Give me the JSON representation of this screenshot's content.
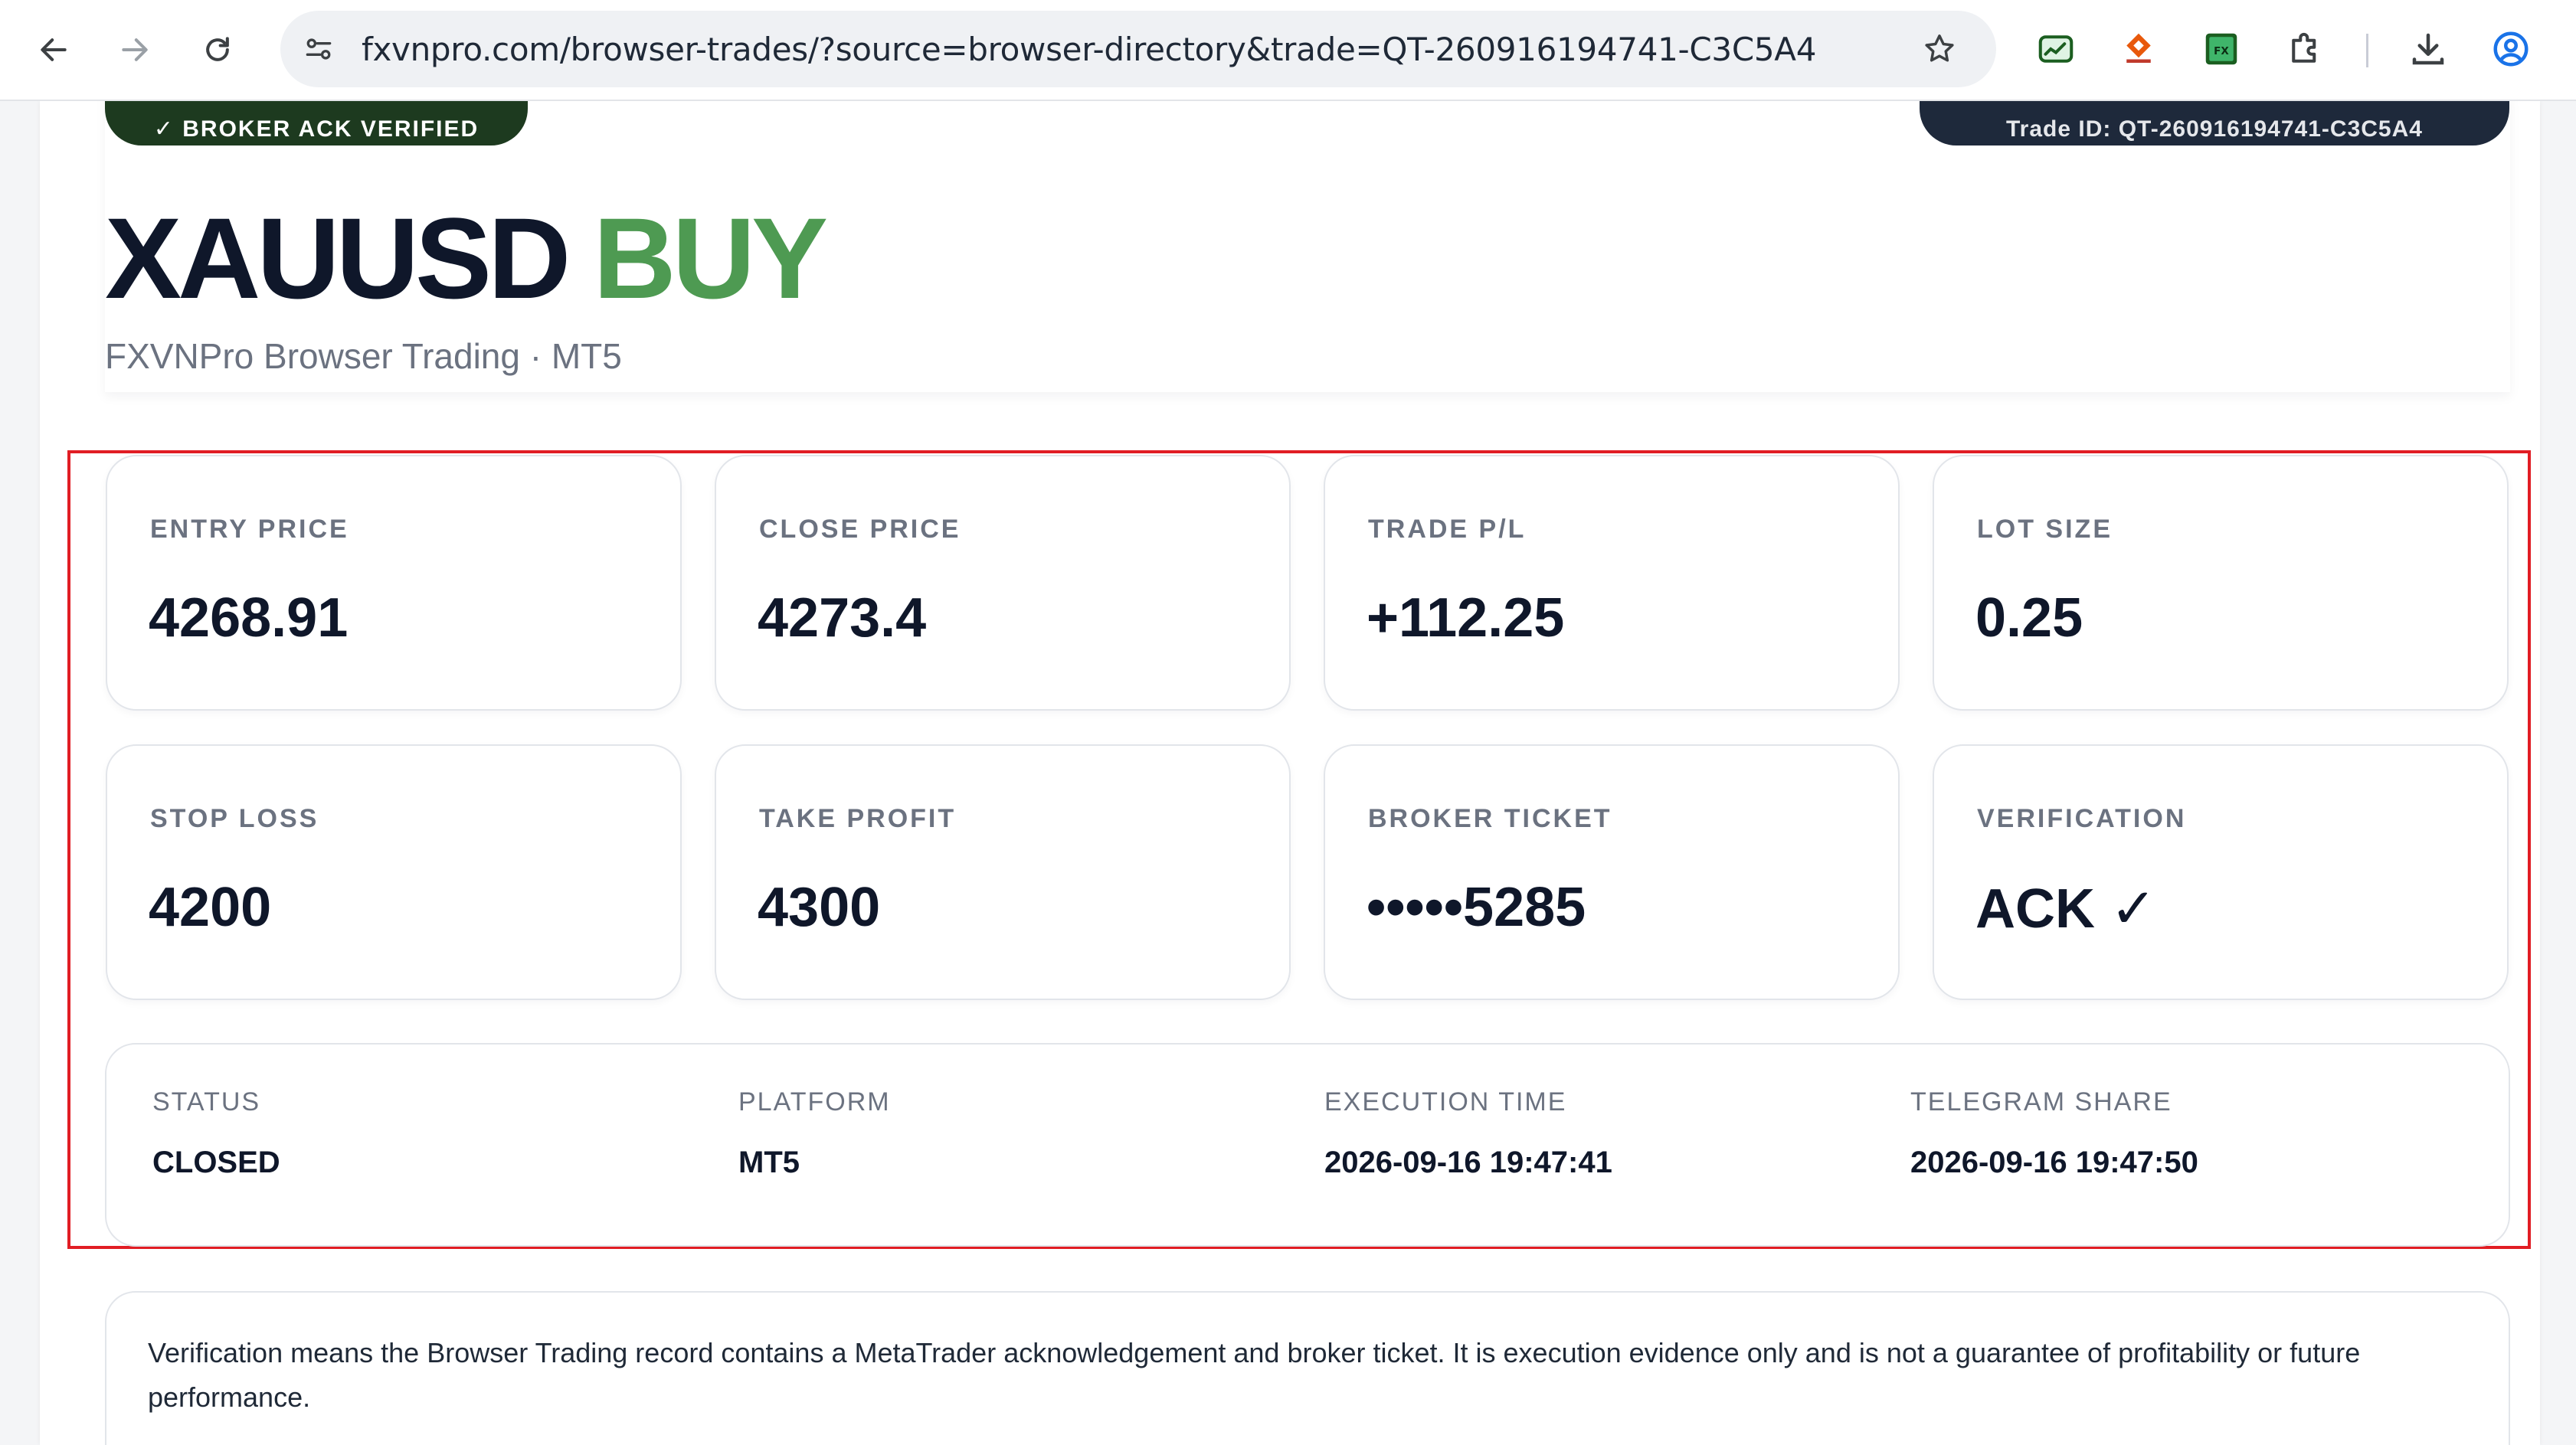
{
  "browser": {
    "url": "fxvnpro.com/browser-trades/?source=browser-directory&trade=QT-260916194741-C3C5A4",
    "toolbar_icons": [
      "back-arrow-icon",
      "forward-arrow-icon",
      "reload-icon",
      "site-info-icon",
      "star-icon",
      "extension-chart-icon",
      "extension-fxvnpro-icon",
      "extension-fx-icon",
      "extensions-puzzle-icon",
      "download-icon",
      "profile-icon"
    ]
  },
  "hero": {
    "ack_badge": "✓ BROKER ACK VERIFIED",
    "trade_id_badge": "Trade ID: QT-260916194741-C3C5A4",
    "symbol": "XAUUSD",
    "side": "BUY",
    "subtitle": "FXVNPro Browser Trading · MT5"
  },
  "stats": [
    {
      "label": "ENTRY PRICE",
      "value": "4268.91"
    },
    {
      "label": "CLOSE PRICE",
      "value": "4273.4"
    },
    {
      "label": "TRADE P/L",
      "value": "+112.25"
    },
    {
      "label": "LOT SIZE",
      "value": "0.25"
    },
    {
      "label": "STOP LOSS",
      "value": "4200"
    },
    {
      "label": "TAKE PROFIT",
      "value": "4300"
    },
    {
      "label": "BROKER TICKET",
      "value": "•••••5285"
    },
    {
      "label": "VERIFICATION",
      "value": "ACK ✓"
    }
  ],
  "meta": [
    {
      "label": "STATUS",
      "value": "CLOSED"
    },
    {
      "label": "PLATFORM",
      "value": "MT5"
    },
    {
      "label": "EXECUTION TIME",
      "value": "2026-09-16 19:47:41"
    },
    {
      "label": "TELEGRAM SHARE",
      "value": "2026-09-16 19:47:50"
    }
  ],
  "disclaimer": "Verification means the Browser Trading record contains a MetaTrader acknowledgement and broker ticket. It is execution evidence only and is not a guarantee of profitability or future performance.",
  "colors": {
    "buy_green": "#4e9a52",
    "ack_badge_bg": "#1d3a1f",
    "trade_badge_bg": "#1e293b",
    "highlight_red": "#e11d24"
  }
}
